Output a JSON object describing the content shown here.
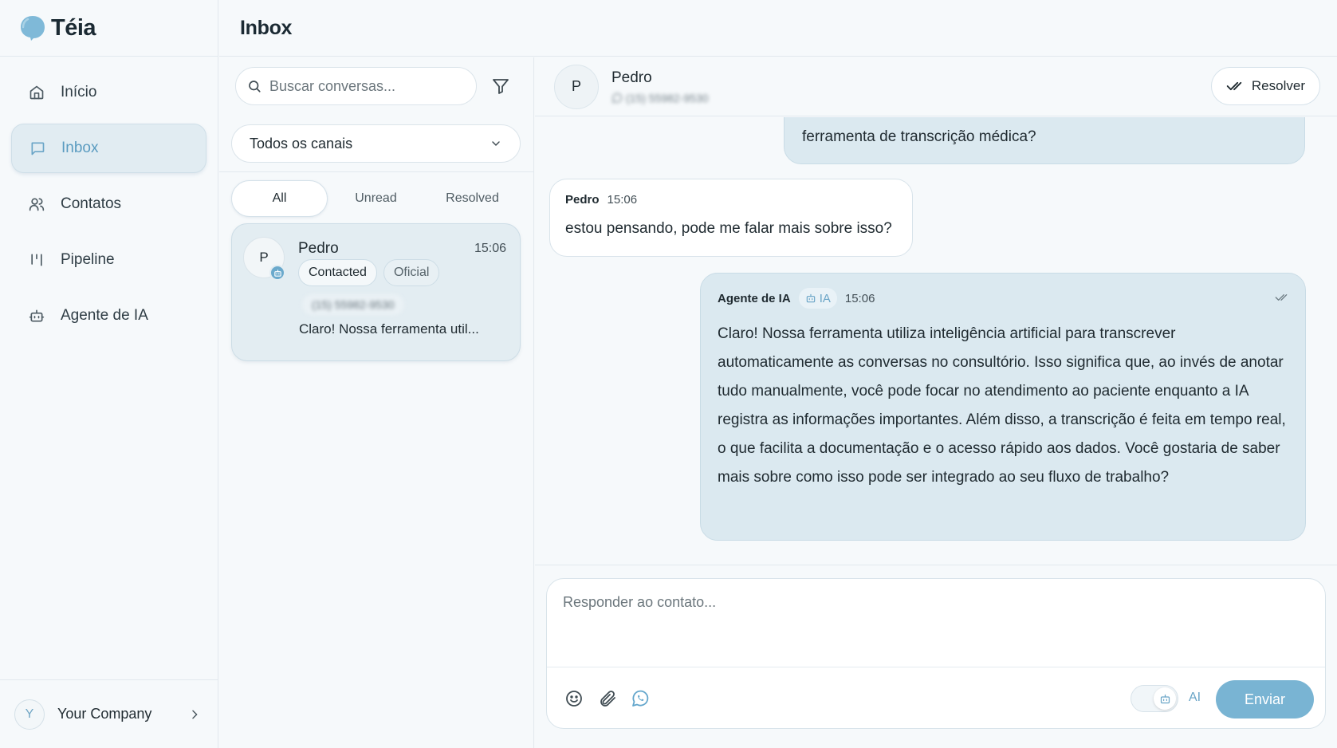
{
  "brand": {
    "name": "Téia"
  },
  "nav": {
    "items": [
      {
        "label": "Início",
        "icon": "home-icon"
      },
      {
        "label": "Inbox",
        "icon": "message-icon",
        "active": true
      },
      {
        "label": "Contatos",
        "icon": "users-icon"
      },
      {
        "label": "Pipeline",
        "icon": "pipeline-icon"
      },
      {
        "label": "Agente de IA",
        "icon": "bot-icon"
      }
    ]
  },
  "company": {
    "initial": "Y",
    "name": "Your Company"
  },
  "page": {
    "title": "Inbox"
  },
  "list": {
    "search_placeholder": "Buscar conversas...",
    "channel_select": "Todos os canais",
    "tabs": [
      {
        "label": "All",
        "active": true
      },
      {
        "label": "Unread"
      },
      {
        "label": "Resolved"
      }
    ],
    "conversations": [
      {
        "initial": "P",
        "name": "Pedro",
        "time": "15:06",
        "tags": [
          "Contacted",
          "Oficial"
        ],
        "phone": "(15) 55982-9530",
        "preview": "Claro! Nossa ferramenta util..."
      }
    ]
  },
  "chat": {
    "contact": {
      "initial": "P",
      "name": "Pedro",
      "phone": "(15) 55982-9530"
    },
    "resolve_label": "Resolver",
    "messages": [
      {
        "text": "ferramenta de transcrição médica?"
      },
      {
        "author": "Pedro",
        "time": "15:06",
        "text": "estou pensando, pode me falar mais sobre isso?"
      },
      {
        "author": "Agente de IA",
        "badge": "IA",
        "time": "15:06",
        "text": "Claro! Nossa ferramenta utiliza inteligência artificial para transcrever automaticamente as conversas no consultório. Isso significa que, ao invés de anotar tudo manualmente, você pode focar no atendimento ao paciente enquanto a IA registra as informações importantes. Além disso, a transcrição é feita em tempo real, o que facilita a documentação e o acesso rápido aos dados. Você gostaria de saber mais sobre como isso pode ser integrado ao seu fluxo de trabalho?"
      }
    ],
    "composer": {
      "placeholder": "Responder ao contato...",
      "ai_label": "AI",
      "send_label": "Enviar"
    }
  },
  "colors": {
    "accent": "#6aa5c7",
    "send_button": "#79b4d3",
    "bubble_out": "#dbe9f0"
  }
}
